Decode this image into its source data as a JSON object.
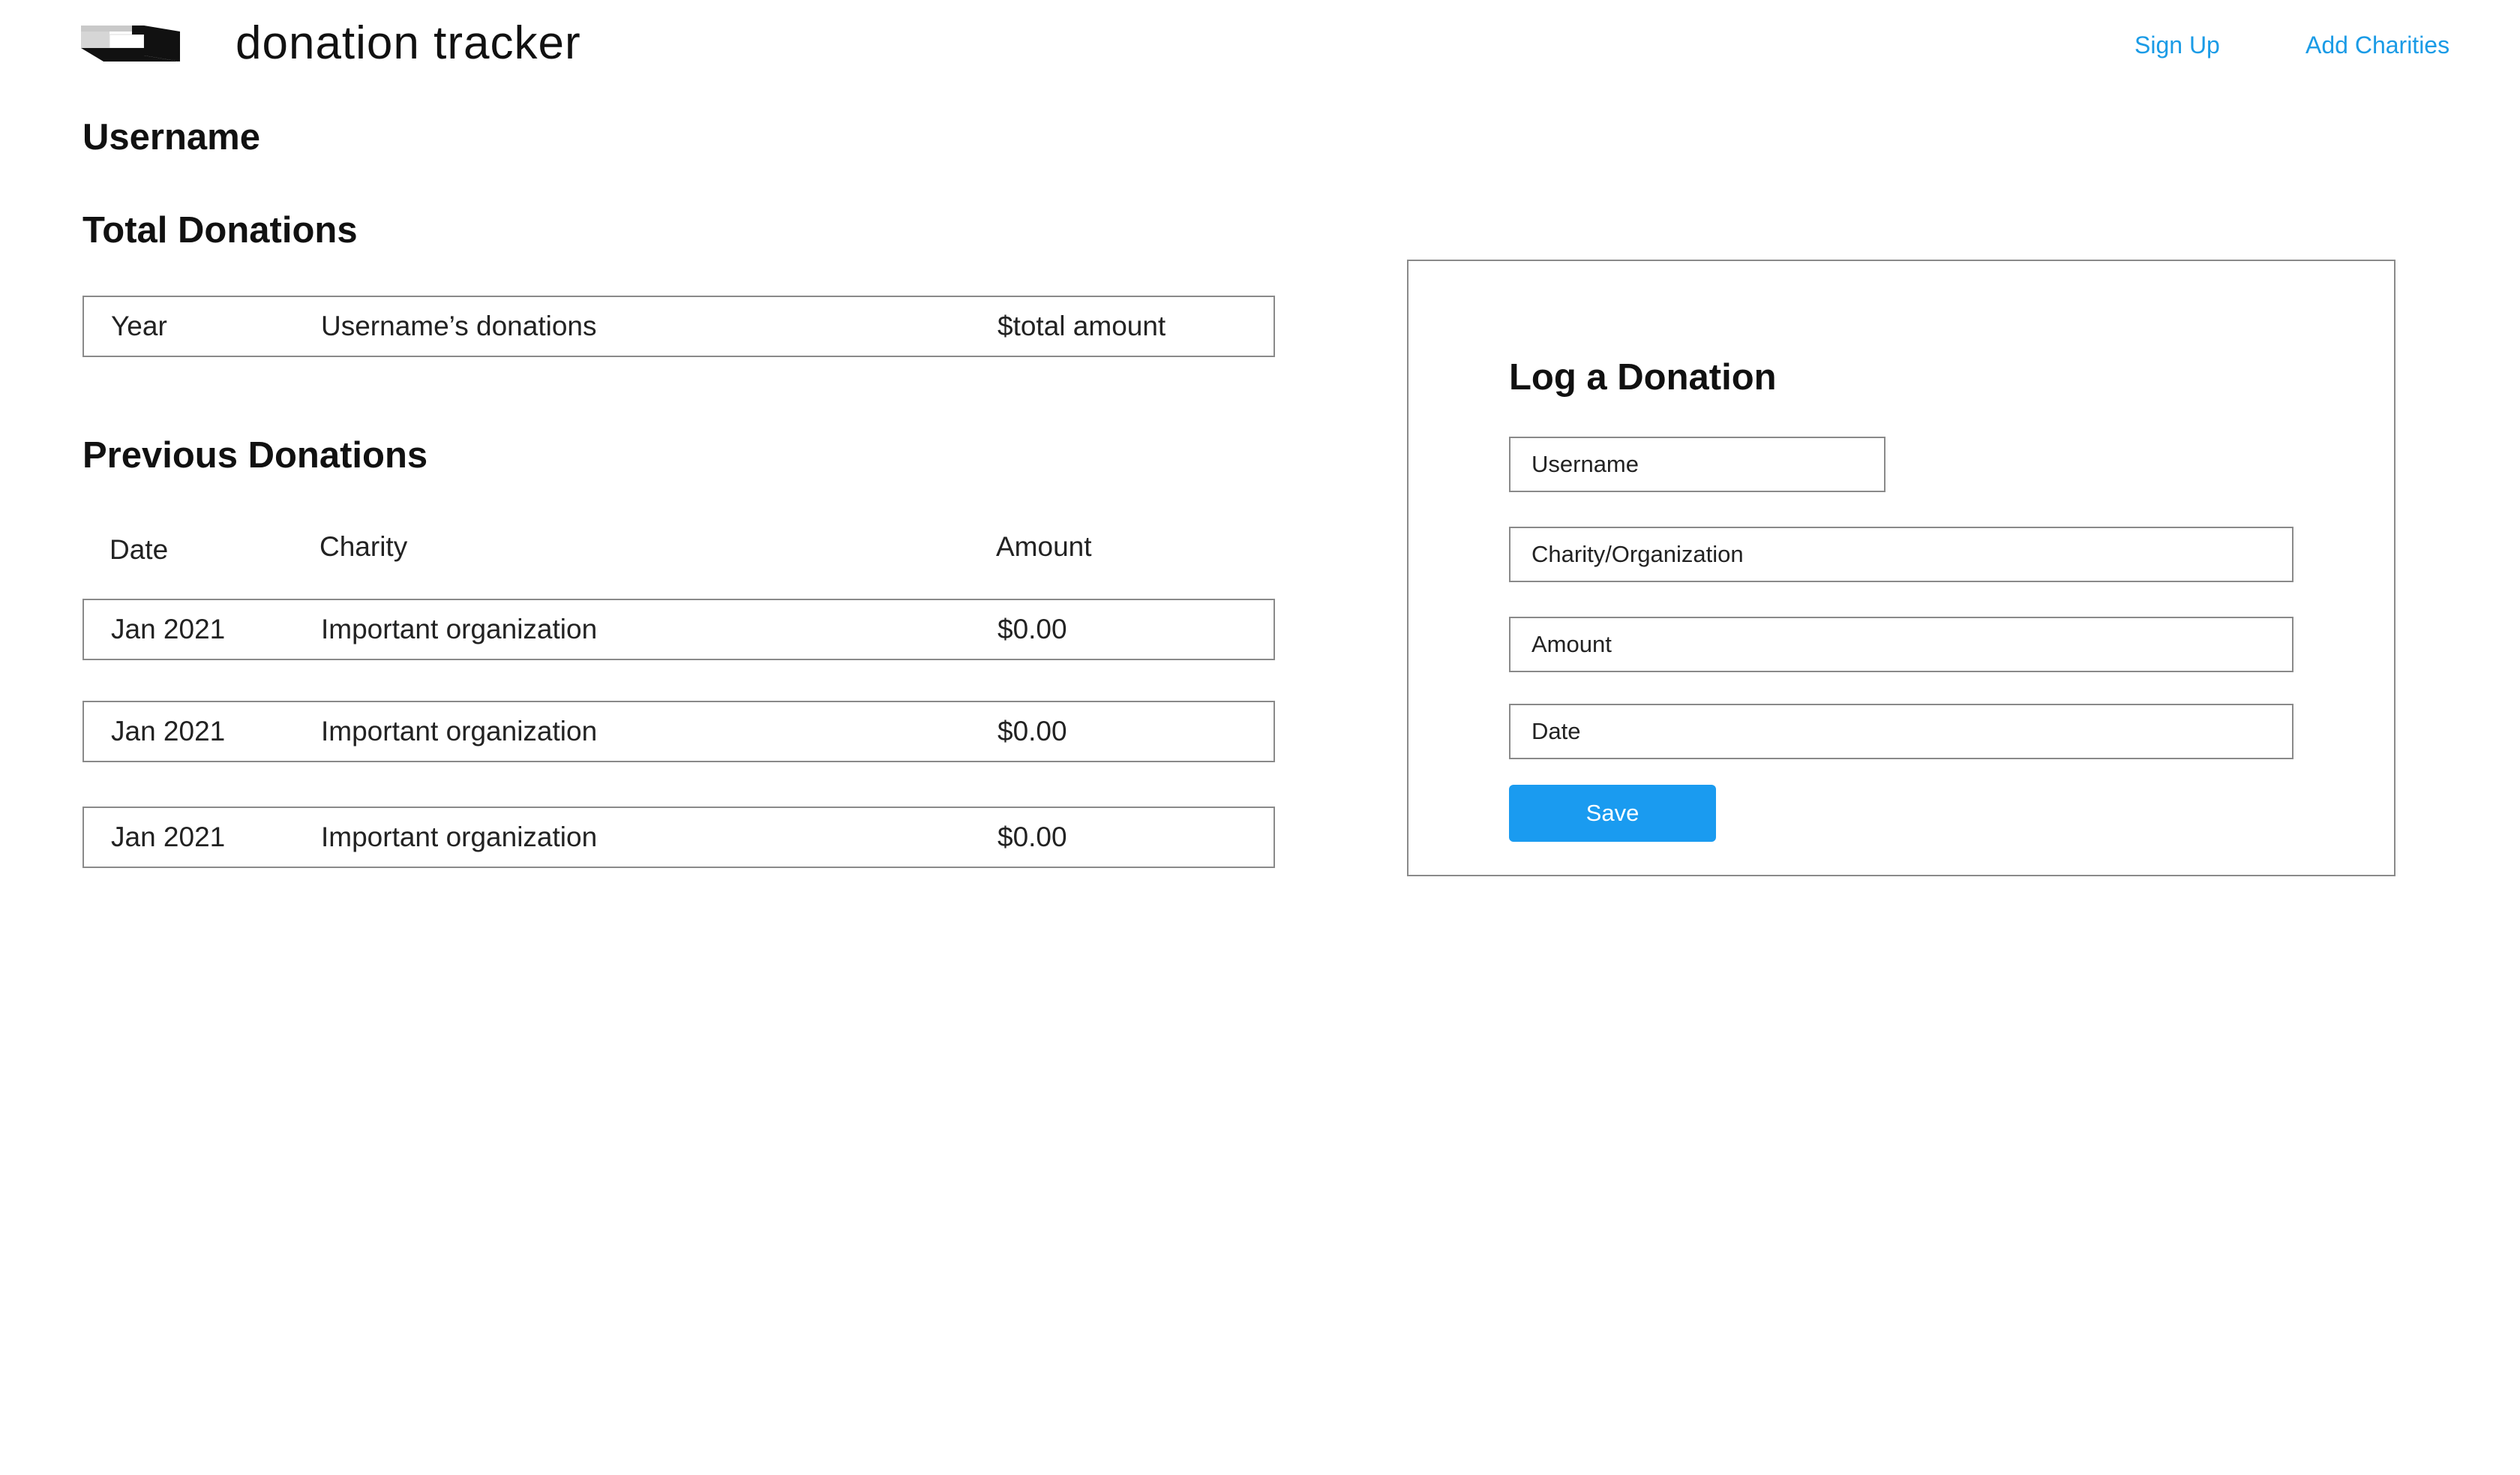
{
  "header": {
    "app_title": "donation tracker",
    "logo_icon": "box-logo-icon",
    "nav": {
      "sign_up": "Sign Up",
      "add_charities": "Add Charities"
    }
  },
  "main": {
    "username_heading": "Username",
    "total_donations": {
      "title": "Total Donations",
      "row": {
        "year": "Year",
        "label": "Username’s donations",
        "amount": "$total amount"
      }
    },
    "previous_donations": {
      "title": "Previous Donations",
      "columns": [
        "Date",
        "Charity",
        "Amount"
      ],
      "rows": [
        {
          "date": "Jan 2021",
          "charity": "Important organization",
          "amount": "$0.00"
        },
        {
          "date": "Jan 2021",
          "charity": "Important organization",
          "amount": "$0.00"
        },
        {
          "date": "Jan 2021",
          "charity": "Important organization",
          "amount": "$0.00"
        }
      ]
    }
  },
  "log_form": {
    "title": "Log a Donation",
    "username_placeholder": "Username",
    "charity_placeholder": "Charity/Organization",
    "amount_placeholder": "Amount",
    "date_placeholder": "Date",
    "save_label": "Save"
  },
  "colors": {
    "accent": "#1a9bf0",
    "link": "#1a9be6",
    "border": "#8a8a8a"
  }
}
